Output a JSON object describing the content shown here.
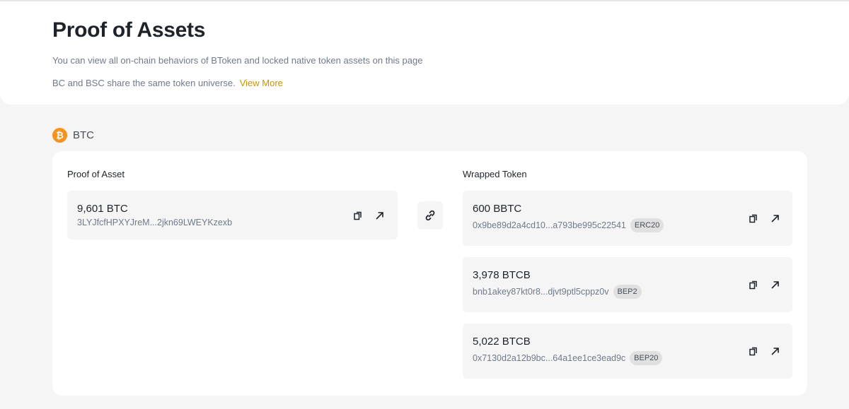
{
  "header": {
    "title": "Proof of Assets",
    "description": "You can view all on-chain behaviors of BToken and locked native token assets on this page",
    "note": "BC and BSC share the same token universe.",
    "view_more": "View More"
  },
  "section": {
    "icon_glyph": "₿",
    "label": "BTC"
  },
  "proof": {
    "title": "Proof of Asset",
    "amount": "9,601 BTC",
    "address": "3LYJfcfHPXYJreM...2jkn69LWEYKzexb"
  },
  "wrapped": {
    "title": "Wrapped Token",
    "items": [
      {
        "amount": "600 BBTC",
        "address": "0x9be89d2a4cd10...a793be995c22541",
        "badge": "ERC20"
      },
      {
        "amount": "3,978 BTCB",
        "address": "bnb1akey87kt0r8...djvt9ptl5cppz0v",
        "badge": "BEP2"
      },
      {
        "amount": "5,022 BTCB",
        "address": "0x7130d2a12b9bc...64a1ee1ce3ead9c",
        "badge": "BEP20"
      }
    ]
  },
  "colors": {
    "accent": "#c99400",
    "btc": "#f7931a"
  }
}
